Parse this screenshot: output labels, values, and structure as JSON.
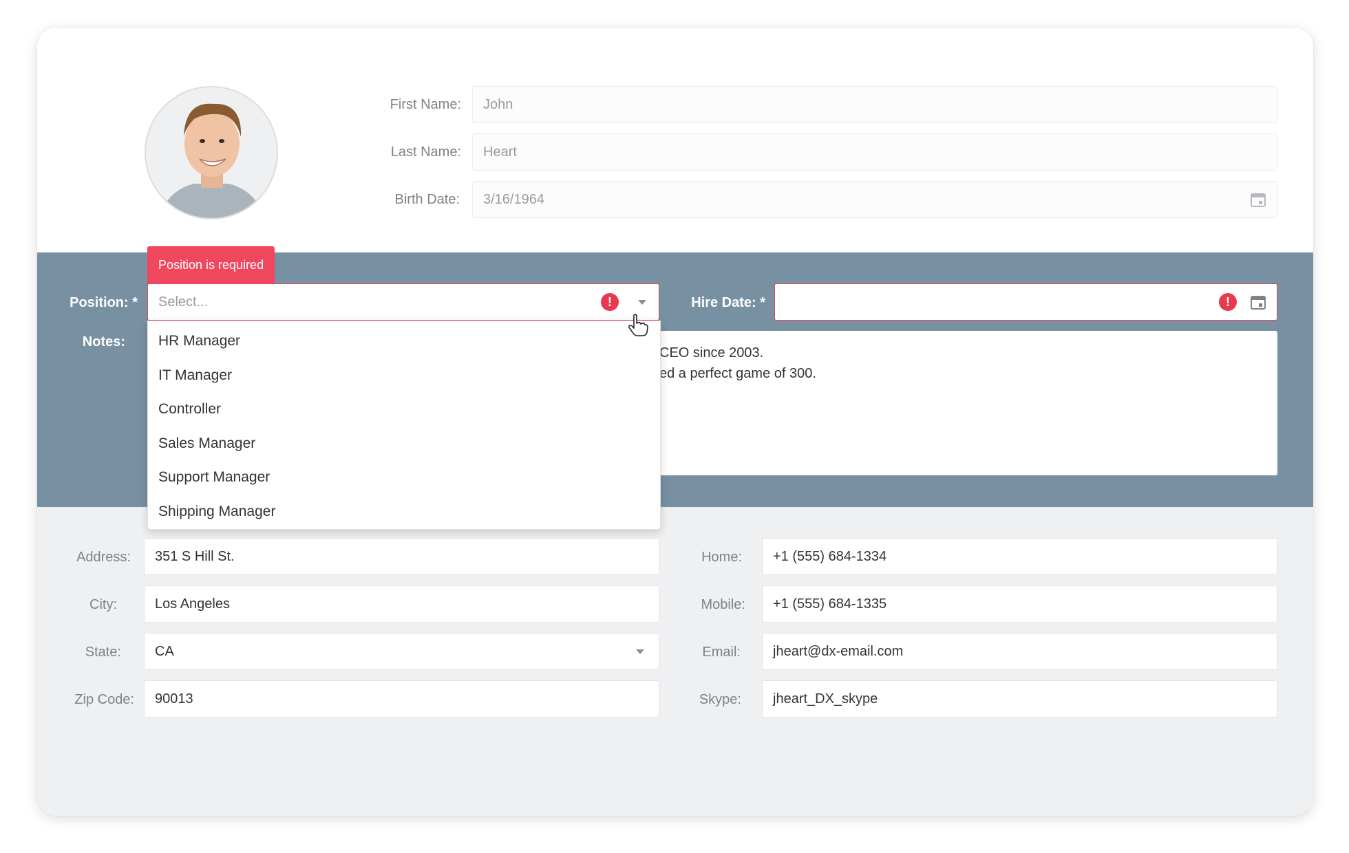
{
  "personal": {
    "first_name_label": "First Name:",
    "first_name_value": "John",
    "last_name_label": "Last Name:",
    "last_name_value": "Heart",
    "birth_date_label": "Birth Date:",
    "birth_date_value": "3/16/1964",
    "avatar_icon": "person-photo-icon"
  },
  "employment": {
    "position_label": "Position: *",
    "position_placeholder": "Select...",
    "position_error": "Position is required",
    "hire_date_label": "Hire Date: *",
    "hire_date_value": "",
    "notes_label": "Notes:",
    "notes_lines": [
      "CEO since 2003.",
      "ed a perfect game of 300."
    ],
    "position_options": [
      "HR Manager",
      "IT Manager",
      "Controller",
      "Sales Manager",
      "Support Manager",
      "Shipping Manager"
    ]
  },
  "contact": {
    "address_label": "Address:",
    "address_value": "351 S Hill St.",
    "city_label": "City:",
    "city_value": "Los Angeles",
    "state_label": "State:",
    "state_value": "CA",
    "zip_label": "Zip Code:",
    "zip_value": "90013",
    "home_label": "Home:",
    "home_value": "+1 (555) 684-1334",
    "mobile_label": "Mobile:",
    "mobile_value": "+1 (555) 684-1335",
    "email_label": "Email:",
    "email_value": "jheart@dx-email.com",
    "skype_label": "Skype:",
    "skype_value": "jheart_DX_skype"
  },
  "colors": {
    "accent_error": "#f0475e",
    "middle_section": "#7790a2",
    "bottom_section": "#eff0f2"
  }
}
